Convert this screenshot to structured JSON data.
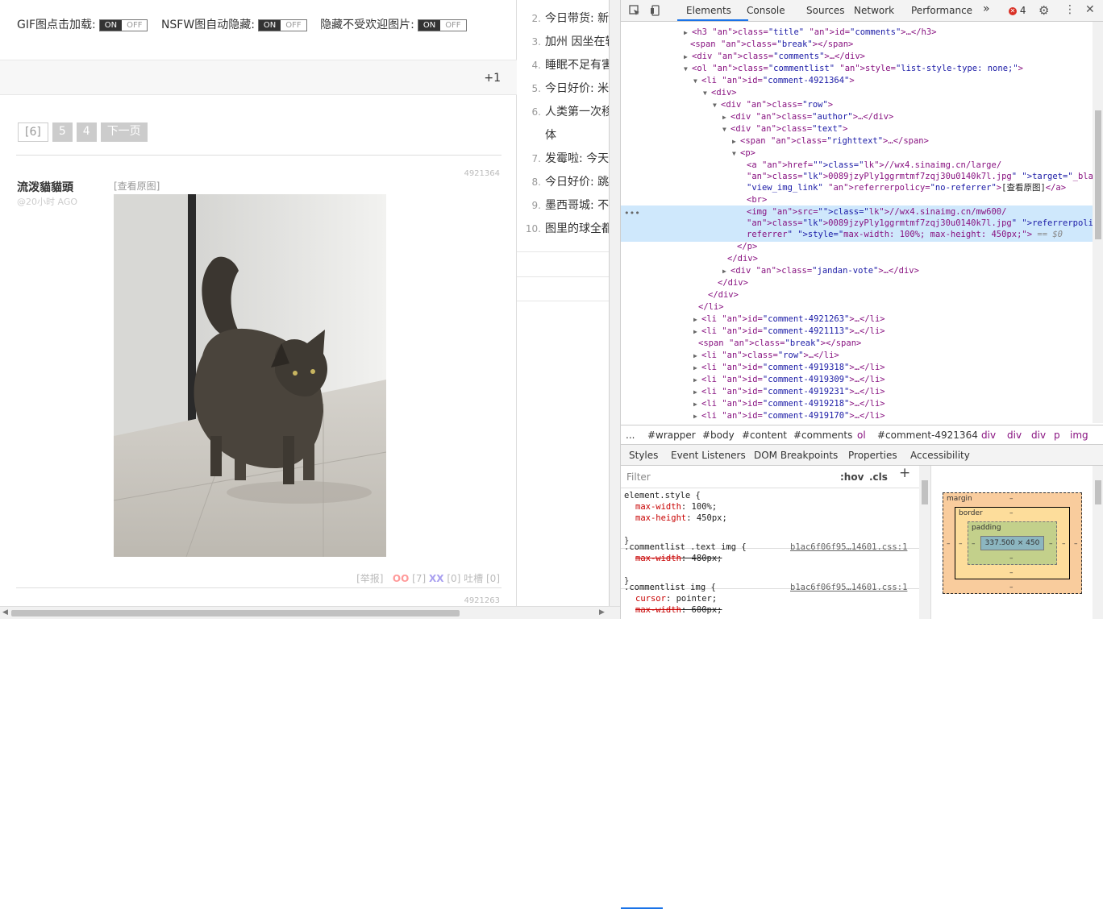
{
  "toggles": [
    {
      "label": "GIF图点击加载:",
      "on": "ON",
      "off": "OFF"
    },
    {
      "label": "NSFW图自动隐藏:",
      "on": "ON",
      "off": "OFF"
    },
    {
      "label": "隐藏不受欢迎图片:",
      "on": "ON",
      "off": "OFF"
    }
  ],
  "plus_one": "+1",
  "pager": {
    "current": "[6]",
    "p5": "5",
    "p4": "4",
    "next": "下一页"
  },
  "comment": {
    "id": "4921364",
    "author": "流泼貓貓頭",
    "ago": "@20小时 AGO",
    "view_original": "[查看原图]",
    "report": "[举报]",
    "oo": "OO",
    "oo_count": "[7]",
    "xx": "XX",
    "xx_count": "[0]",
    "tucao": "吐槽",
    "tucao_count": "[0]",
    "next_id": "4921263"
  },
  "sidebar": {
    "items": [
      {
        "n": "2.",
        "t": "今日带货: 新"
      },
      {
        "n": "3.",
        "t": "加州 因坐在转"
      },
      {
        "n": "4.",
        "t": "睡眠不足有害"
      },
      {
        "n": "5.",
        "t": "今日好价: 米"
      },
      {
        "n": "6.",
        "t": "人类第一次移"
      },
      {
        "n": "",
        "t": "体"
      },
      {
        "n": "7.",
        "t": "发霉啦: 今天"
      },
      {
        "n": "8.",
        "t": "今日好价: 跳"
      },
      {
        "n": "9.",
        "t": "墨西哥城: 不"
      },
      {
        "n": "10.",
        "t": "图里的球全都"
      }
    ]
  },
  "devtools": {
    "tabs": [
      "Elements",
      "Console",
      "Sources",
      "Network",
      "Performance"
    ],
    "more": "»",
    "error_count": "4",
    "tree": [
      {
        "t": "<h3 class=\"title\" id=\"comments\">…</h3>"
      },
      {
        "t": "<span class=\"break\"></span>"
      },
      {
        "t": "<div class=\"comments\">…</div>"
      },
      {
        "t": "<ol class=\"commentlist\" style=\"list-style-type: none;\">"
      },
      {
        "t": "<li id=\"comment-4921364\">"
      },
      {
        "t": "<div>"
      },
      {
        "t": "<div class=\"row\">"
      },
      {
        "t": "<div class=\"author\">…</div>"
      },
      {
        "t": "<div class=\"text\">"
      },
      {
        "t": "<span class=\"righttext\">…</span>"
      },
      {
        "t": "<p>"
      },
      {
        "t": "<a href=\"//wx4.sinaimg.cn/large/"
      },
      {
        "t": "0089jzyPly1ggrmtmf7zqj30u0140k7l.jpg\" target=\"_blank\" class="
      },
      {
        "t": "\"view_img_link\" referrerpolicy=\"no-referrer\">[查看原图]</a>"
      },
      {
        "t": "<br>"
      },
      {
        "t": "<img src=\"//wx4.sinaimg.cn/mw600/"
      },
      {
        "t": "0089jzyPly1ggrmtmf7zqj30u0140k7l.jpg\" referrerpolicy=\"no-"
      },
      {
        "t": "referrer\" style=\"max-width: 100%; max-height: 450px;\"> == $0"
      },
      {
        "t": "</p>"
      },
      {
        "t": "</div>"
      },
      {
        "t": "<div class=\"jandan-vote\">…</div>"
      },
      {
        "t": "</div>"
      },
      {
        "t": "</div>"
      },
      {
        "t": "</li>"
      },
      {
        "t": "<li id=\"comment-4921263\">…</li>"
      },
      {
        "t": "<li id=\"comment-4921113\">…</li>"
      },
      {
        "t": "<span class=\"break\"></span>"
      },
      {
        "t": "<li class=\"row\">…</li>"
      },
      {
        "t": "<li id=\"comment-4919318\">…</li>"
      },
      {
        "t": "<li id=\"comment-4919309\">…</li>"
      },
      {
        "t": "<li id=\"comment-4919231\">…</li>"
      },
      {
        "t": "<li id=\"comment-4919218\">…</li>"
      },
      {
        "t": "<li id=\"comment-4919170\">…</li>"
      }
    ],
    "crumbs": [
      "...",
      "#wrapper",
      "#body",
      "#content",
      "#comments",
      "ol",
      "#comment-4921364",
      "div",
      "div",
      "div",
      "p",
      "img"
    ],
    "subtabs": [
      "Styles",
      "Event Listeners",
      "DOM Breakpoints",
      "Properties",
      "Accessibility"
    ],
    "filter_placeholder": "Filter",
    "hov": ":hov",
    "cls": ".cls",
    "rules": [
      {
        "sel": "element.style {",
        "props": [
          [
            "max-width",
            "100%;"
          ],
          [
            "max-height",
            "450px;"
          ]
        ]
      },
      {
        "sel": ".commentlist .text img {",
        "src": "b1ac6f06f95…14601.css:1",
        "props": [
          [
            "max-width",
            "480px;"
          ]
        ]
      },
      {
        "sel": ".commentlist img {",
        "src": "b1ac6f06f95…14601.css:1",
        "props": [
          [
            "cursor",
            "pointer;"
          ],
          [
            "max-width",
            "600px;"
          ]
        ]
      }
    ],
    "box": {
      "margin": "margin",
      "border": "border",
      "padding": "padding",
      "content": "337.500 × 450",
      "dash": "–"
    }
  }
}
